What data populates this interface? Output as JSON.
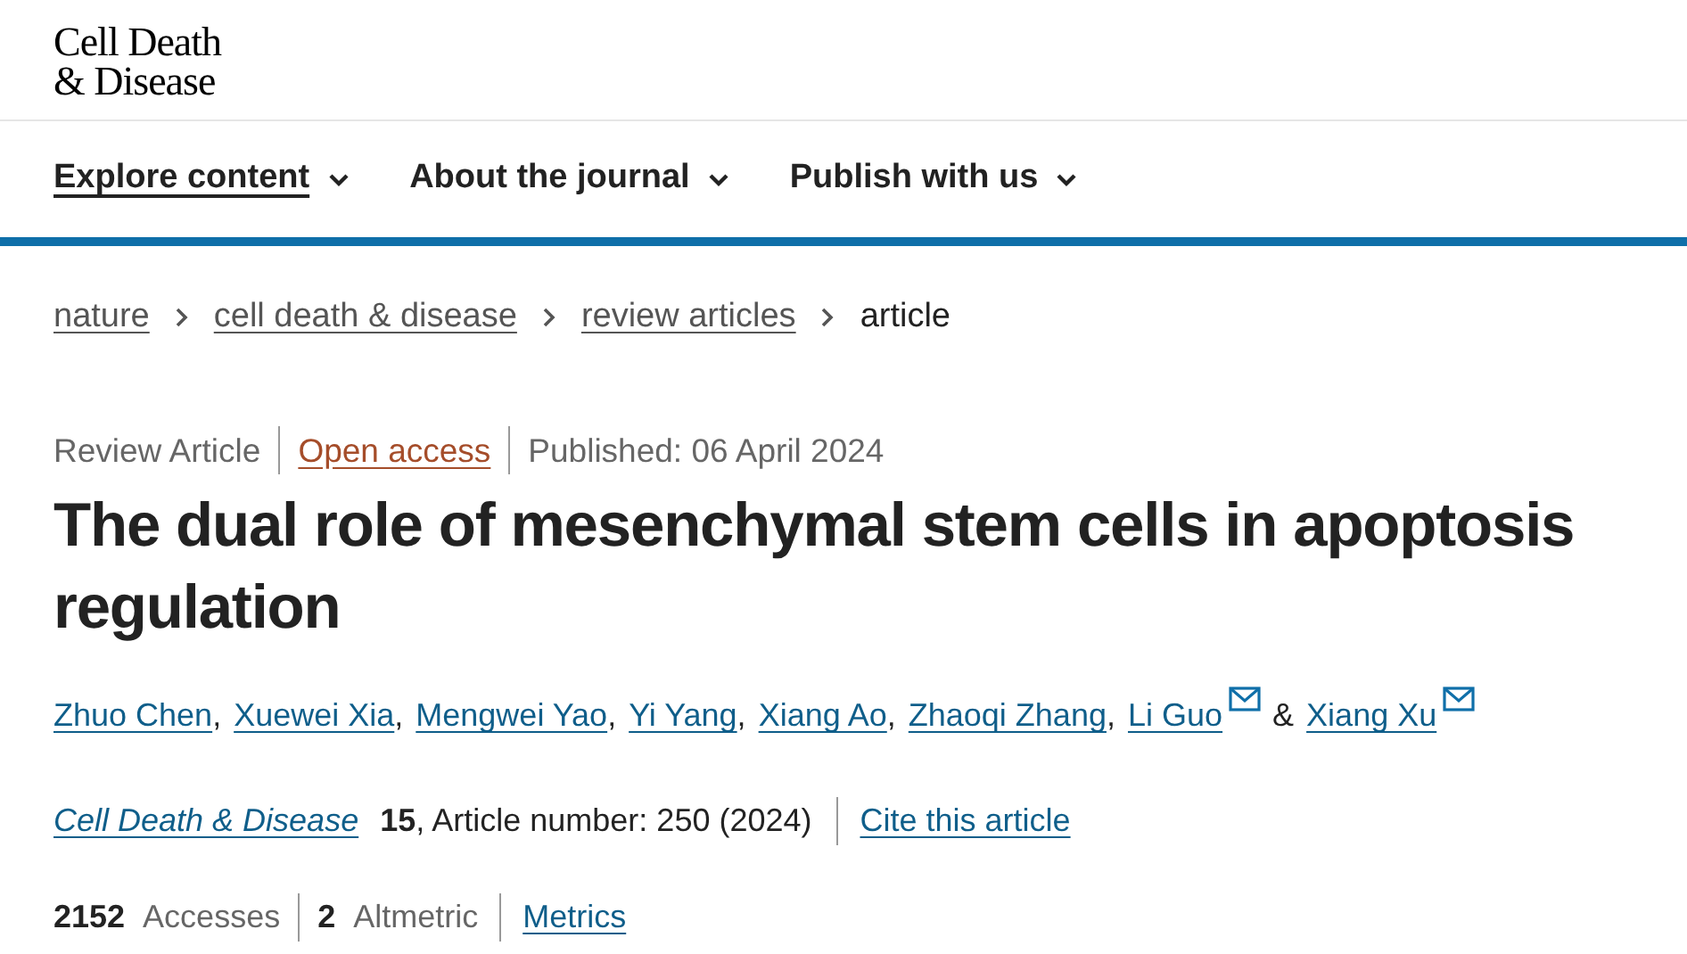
{
  "logo": {
    "line_1": "Cell Death",
    "line_2": "& Disease"
  },
  "nav": [
    {
      "label": "Explore content",
      "selected": true
    },
    {
      "label": "About the journal",
      "selected": false
    },
    {
      "label": "Publish with us",
      "selected": false
    }
  ],
  "breadcrumbs": [
    {
      "label": "nature",
      "kind": "link"
    },
    {
      "label": "cell death & disease",
      "kind": "link"
    },
    {
      "label": "review articles",
      "kind": "link"
    },
    {
      "label": "article",
      "kind": "current"
    }
  ],
  "article_type": "Review Article",
  "access": "Open access",
  "published": "Published: 06 April 2024",
  "title": "The dual role of mesenchymal stem cells in apoptosis regulation",
  "authors": [
    {
      "name": "Zhuo Chen",
      "contact": false,
      "separator": ","
    },
    {
      "name": "Xuewei Xia",
      "contact": false,
      "separator": ","
    },
    {
      "name": "Mengwei Yao",
      "contact": false,
      "separator": ","
    },
    {
      "name": "Yi Yang",
      "contact": false,
      "separator": ","
    },
    {
      "name": "Xiang Ao",
      "contact": false,
      "separator": ","
    },
    {
      "name": "Zhaoqi Zhang",
      "contact": false,
      "separator": ","
    },
    {
      "name": "Li Guo",
      "contact": true,
      "separator": "&"
    },
    {
      "name": "Xiang Xu",
      "contact": true
    }
  ],
  "citation": {
    "journal": "Cell Death & Disease",
    "volume": "15",
    "details": ", Article number: 250 (2024)",
    "cite_link": "Cite this article"
  },
  "metrics": {
    "accesses_count": "2152",
    "accesses_label": "Accesses",
    "altmetric_count": "2",
    "altmetric_label": "Altmetric",
    "link": "Metrics"
  }
}
